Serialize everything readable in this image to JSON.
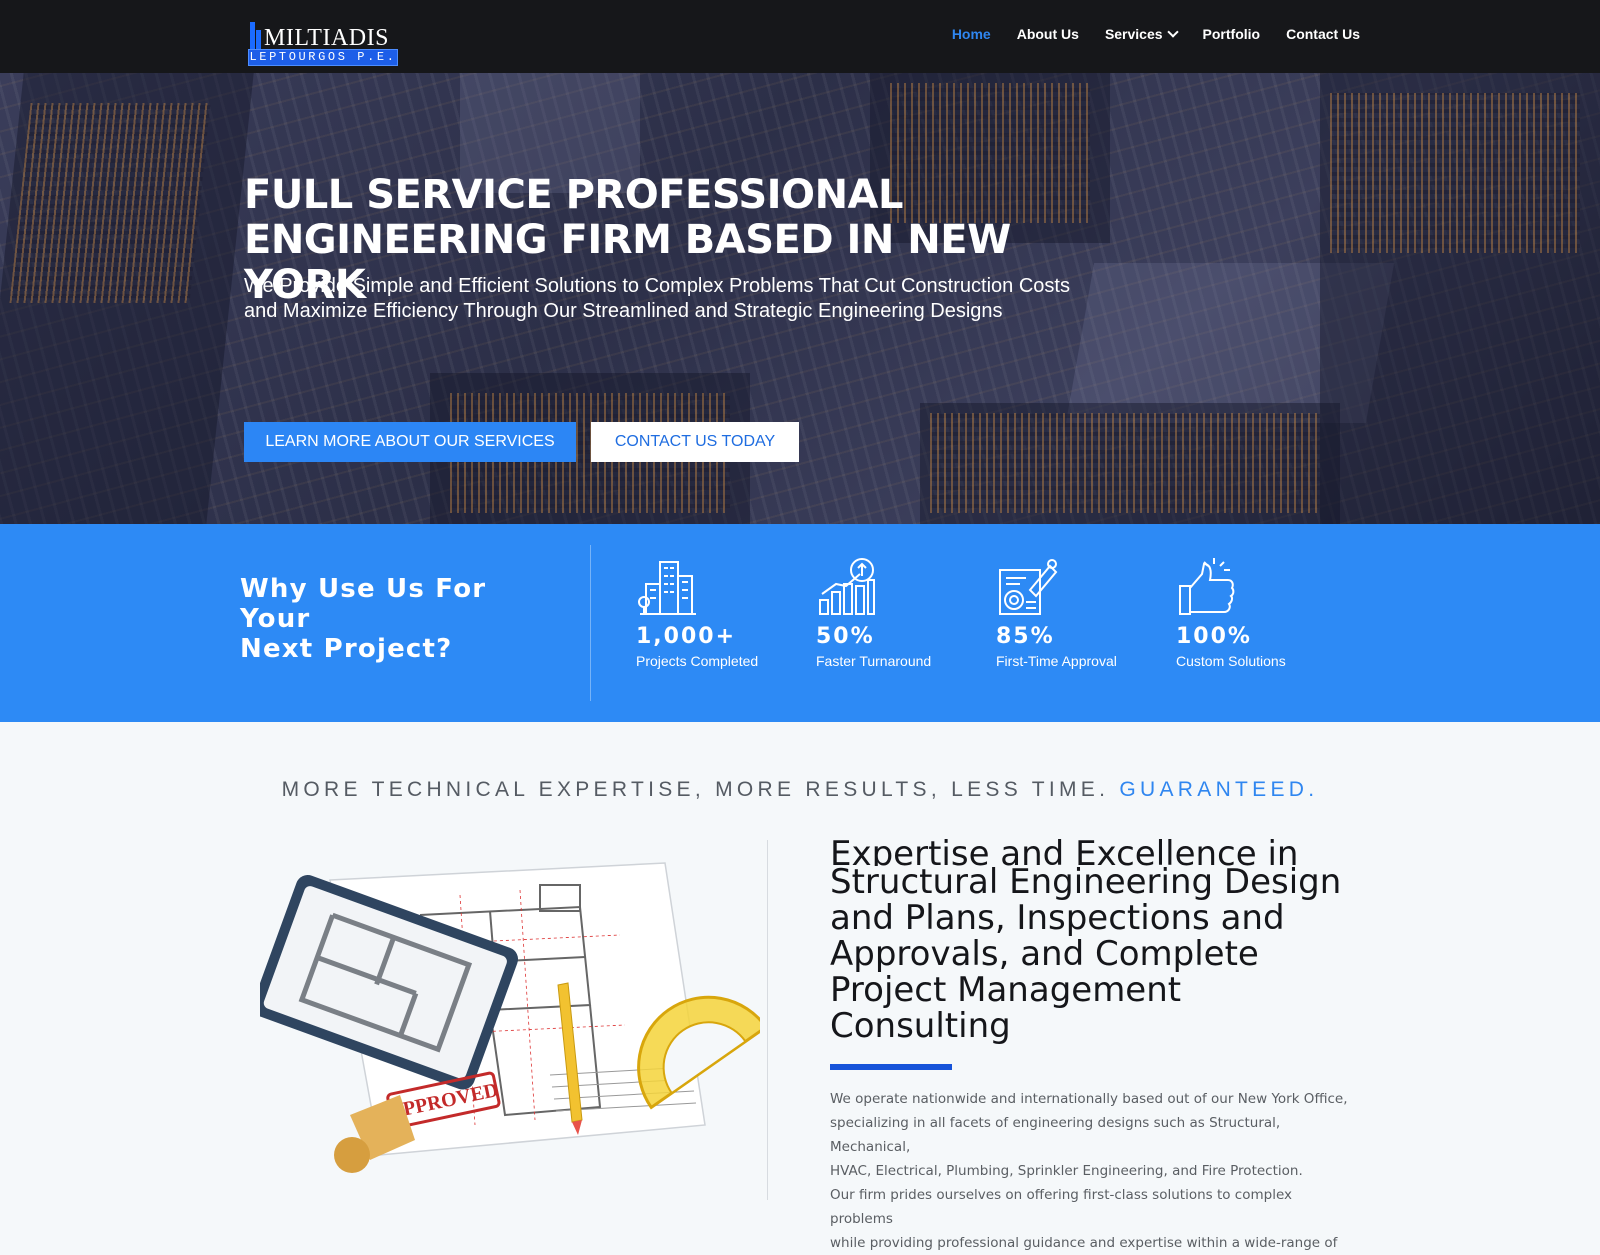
{
  "header": {
    "logo": {
      "name": "MILTIADIS",
      "sub": "LEPTOURGOS P.E."
    },
    "nav": [
      {
        "label": "Home",
        "active": true
      },
      {
        "label": "About Us"
      },
      {
        "label": "Services",
        "dropdown": true
      },
      {
        "label": "Portfolio"
      },
      {
        "label": "Contact Us"
      }
    ]
  },
  "hero": {
    "title_line1": "FULL SERVICE PROFESSIONAL",
    "title_line2": "ENGINEERING FIRM BASED IN NEW YORK",
    "subtitle_line1": "We Provide Simple and Efficient Solutions to Complex Problems That Cut Construction Costs",
    "subtitle_line2": "and Maximize Efficiency Through Our Streamlined and Strategic Engineering Designs",
    "primary_button": "LEARN MORE ABOUT OUR SERVICES",
    "secondary_button": "CONTACT US TODAY"
  },
  "stats": {
    "heading_line1": "Why Use Us For Your",
    "heading_line2": "Next Project?",
    "items": [
      {
        "value": "1,000+",
        "label": "Projects Completed",
        "icon": "city-buildings-icon"
      },
      {
        "value": "50%",
        "label": "Faster Turnaround",
        "icon": "growth-chart-icon"
      },
      {
        "value": "85%",
        "label": "First-Time Approval",
        "icon": "approved-document-icon"
      },
      {
        "value": "100%",
        "label": "Custom Solutions",
        "icon": "thumbs-up-icon"
      }
    ]
  },
  "expertise": {
    "tagline": "MORE TECHNICAL EXPERTISE, MORE RESULTS, LESS TIME.",
    "tagline_accent": "GUARANTEED.",
    "heading_clipped": "Expertise and Excellence in",
    "heading_line1": "Structural Engineering Design",
    "heading_line2": "and Plans, Inspections and",
    "heading_line3": "Approvals, and Complete",
    "heading_line4": "Project Management",
    "heading_line5": "Consulting",
    "body_line1": "We operate nationwide and internationally based out of our New York Office,",
    "body_line2": "specializing in all facets of engineering designs such as Structural, Mechanical,",
    "body_line3": "HVAC, Electrical, Plumbing, Sprinkler Engineering, and Fire Protection.",
    "body_line4": "Our firm prides ourselves on offering first-class solutions to complex problems",
    "body_line5": "while providing professional guidance and expertise within a wide-range of",
    "stamp_text": "APPROVED"
  },
  "colors": {
    "accent": "#2d8af5",
    "header_bg": "#16171a",
    "rule": "#1653d9"
  }
}
